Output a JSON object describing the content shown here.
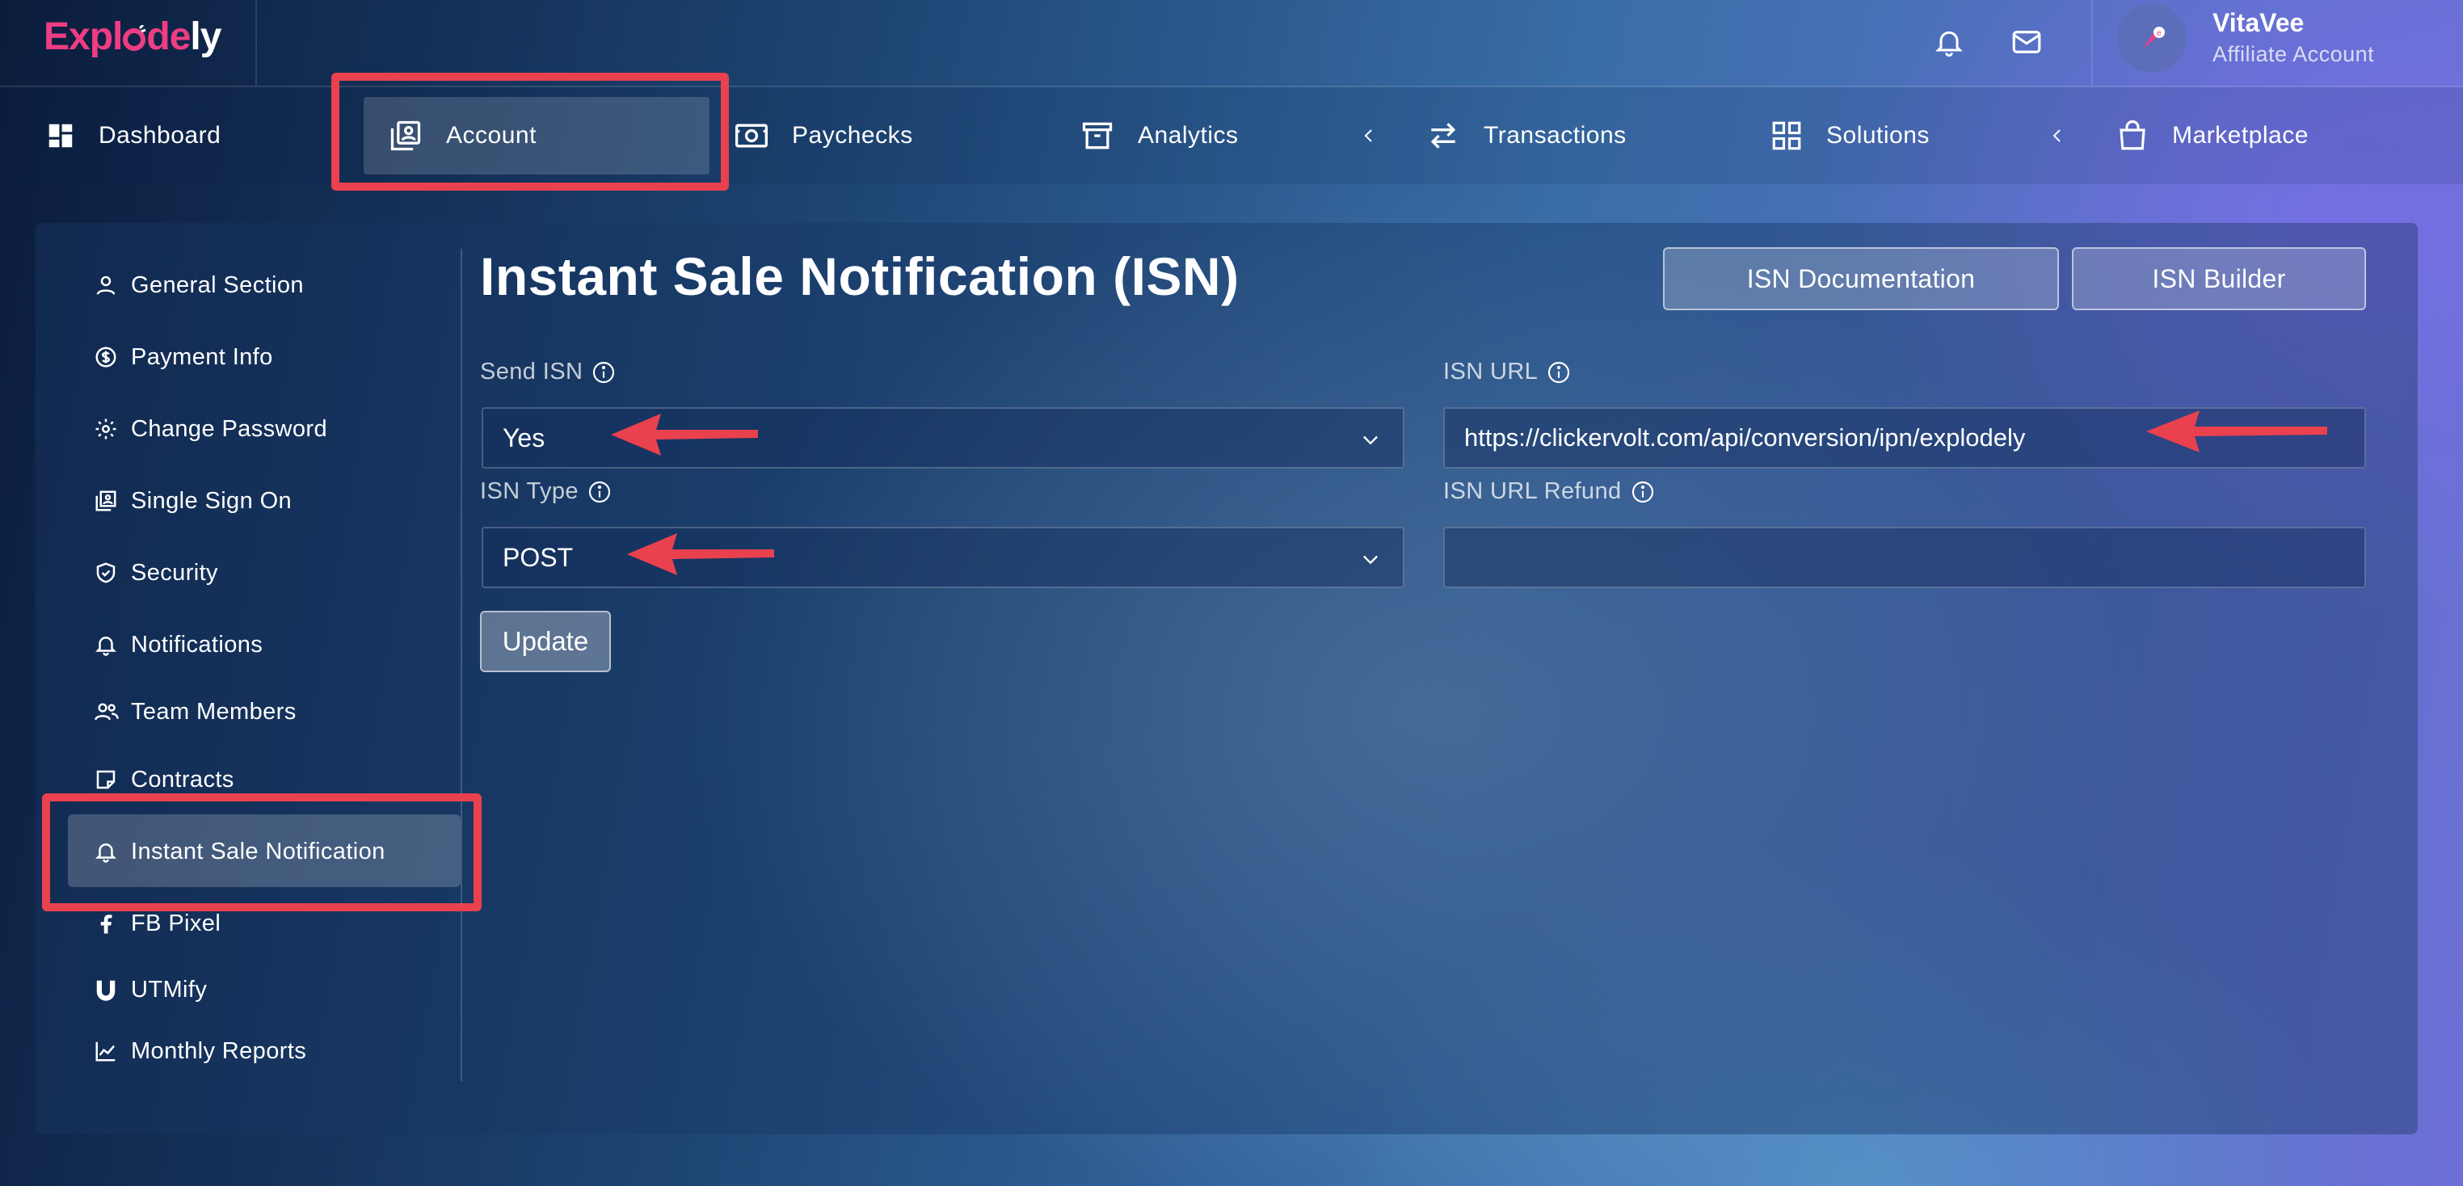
{
  "brand": {
    "logo_part1": "Expl",
    "logo_part2": "de",
    "logo_part3": "ly"
  },
  "user": {
    "name": "VitaVee",
    "role": "Affiliate Account"
  },
  "nav": {
    "items": [
      {
        "label": "Dashboard",
        "icon": "dashboard-icon"
      },
      {
        "label": "Account",
        "icon": "account-box-icon",
        "active": true
      },
      {
        "label": "Paychecks",
        "icon": "money-icon"
      },
      {
        "label": "Analytics",
        "icon": "archive-icon"
      },
      {
        "label": "Transactions",
        "icon": "swap-icon"
      },
      {
        "label": "Solutions",
        "icon": "grid-icon"
      },
      {
        "label": "Marketplace",
        "icon": "shopping-bag-icon"
      }
    ]
  },
  "sidebar": {
    "items": [
      {
        "label": "General Section",
        "icon": "person-icon"
      },
      {
        "label": "Payment Info",
        "icon": "dollar-circle-icon"
      },
      {
        "label": "Change Password",
        "icon": "gear-icon"
      },
      {
        "label": "Single Sign On",
        "icon": "account-box-icon"
      },
      {
        "label": "Security",
        "icon": "shield-icon"
      },
      {
        "label": "Notifications",
        "icon": "bell-icon"
      },
      {
        "label": "Team Members",
        "icon": "people-icon"
      },
      {
        "label": "Contracts",
        "icon": "note-icon"
      },
      {
        "label": "Instant Sale Notification",
        "icon": "bell-icon",
        "active": true
      },
      {
        "label": "FB Pixel",
        "icon": "facebook-icon"
      },
      {
        "label": "UTMify",
        "icon": "utmify-icon"
      },
      {
        "label": "Monthly Reports",
        "icon": "chart-line-icon"
      }
    ]
  },
  "main": {
    "title": "Instant Sale Notification (ISN)",
    "buttons": {
      "docs": "ISN Documentation",
      "builder": "ISN Builder"
    },
    "form": {
      "send_isn": {
        "label": "Send ISN",
        "value": "Yes"
      },
      "isn_type": {
        "label": "ISN Type",
        "value": "POST"
      },
      "isn_url": {
        "label": "ISN URL",
        "value": "https://clickervolt.com/api/conversion/ipn/explodely"
      },
      "isn_url_refund": {
        "label": "ISN URL Refund",
        "value": ""
      },
      "update_label": "Update"
    }
  },
  "colors": {
    "accent_pink": "#ee3d83",
    "annotation_red": "#e9414d"
  }
}
